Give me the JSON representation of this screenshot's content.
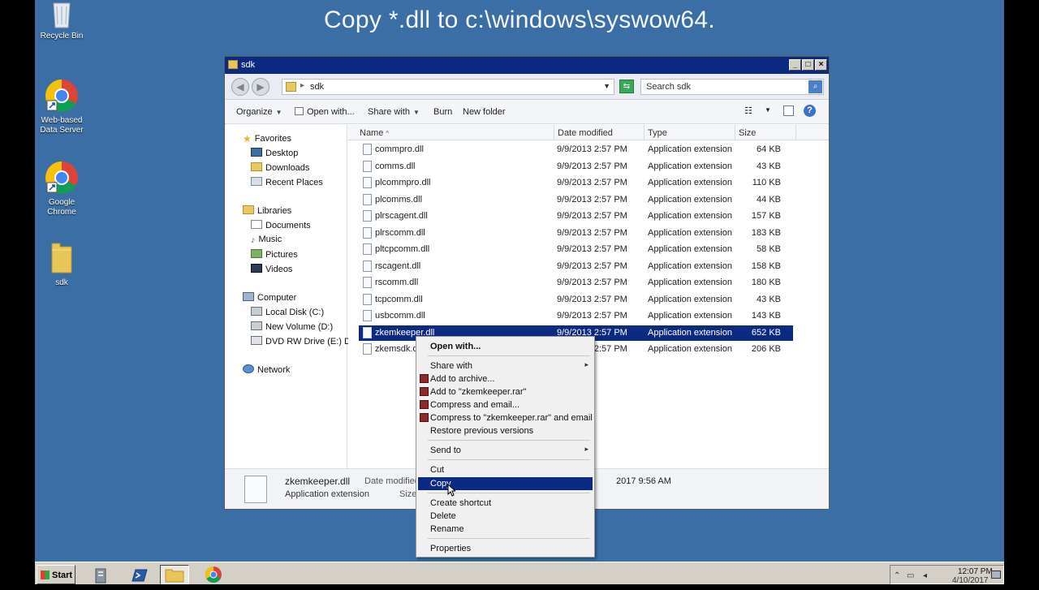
{
  "banner": {
    "text": "Copy *.dll to c:\\windows\\syswow64."
  },
  "desktop": {
    "icons": [
      {
        "label": "Recycle Bin"
      },
      {
        "label": "Web-based Data Server"
      },
      {
        "label": "Google Chrome"
      },
      {
        "label": "sdk"
      }
    ]
  },
  "window": {
    "title": "sdk",
    "address": {
      "path": "sdk"
    },
    "search_placeholder": "Search sdk",
    "toolbar": {
      "organize": "Organize",
      "open_with": "Open with...",
      "share_with": "Share with",
      "burn": "Burn",
      "new_folder": "New folder"
    },
    "nav": {
      "favorites": "Favorites",
      "desktop": "Desktop",
      "downloads": "Downloads",
      "recent_places": "Recent Places",
      "libraries": "Libraries",
      "documents": "Documents",
      "music": "Music",
      "pictures": "Pictures",
      "videos": "Videos",
      "computer": "Computer",
      "local_disk": "Local Disk (C:)",
      "new_volume": "New Volume (D:)",
      "dvd_drive": "DVD RW Drive (E:) DH",
      "network": "Network"
    },
    "columns": {
      "name": "Name",
      "date": "Date modified",
      "type": "Type",
      "size": "Size"
    },
    "files": [
      {
        "name": "commpro.dll",
        "date": "9/9/2013 2:57 PM",
        "type": "Application extension",
        "size": "64 KB"
      },
      {
        "name": "comms.dll",
        "date": "9/9/2013 2:57 PM",
        "type": "Application extension",
        "size": "43 KB"
      },
      {
        "name": "plcommpro.dll",
        "date": "9/9/2013 2:57 PM",
        "type": "Application extension",
        "size": "110 KB"
      },
      {
        "name": "plcomms.dll",
        "date": "9/9/2013 2:57 PM",
        "type": "Application extension",
        "size": "44 KB"
      },
      {
        "name": "plrscagent.dll",
        "date": "9/9/2013 2:57 PM",
        "type": "Application extension",
        "size": "157 KB"
      },
      {
        "name": "plrscomm.dll",
        "date": "9/9/2013 2:57 PM",
        "type": "Application extension",
        "size": "183 KB"
      },
      {
        "name": "pltcpcomm.dll",
        "date": "9/9/2013 2:57 PM",
        "type": "Application extension",
        "size": "58 KB"
      },
      {
        "name": "rscagent.dll",
        "date": "9/9/2013 2:57 PM",
        "type": "Application extension",
        "size": "158 KB"
      },
      {
        "name": "rscomm.dll",
        "date": "9/9/2013 2:57 PM",
        "type": "Application extension",
        "size": "180 KB"
      },
      {
        "name": "tcpcomm.dll",
        "date": "9/9/2013 2:57 PM",
        "type": "Application extension",
        "size": "43 KB"
      },
      {
        "name": "usbcomm.dll",
        "date": "9/9/2013 2:57 PM",
        "type": "Application extension",
        "size": "143 KB"
      },
      {
        "name": "zkemkeeper.dll",
        "date": "9/9/2013 2:57 PM",
        "type": "Application extension",
        "size": "652 KB"
      },
      {
        "name": "zkemsdk.dll",
        "date": "9/9/2013 2:57 PM",
        "type": "Application extension",
        "size": "206 KB"
      }
    ],
    "details": {
      "filename": "zkemkeeper.dll",
      "filetype": "Application extension",
      "date_label": "Date modified",
      "date_value": "2017 9:56 AM",
      "size_label": "Size"
    }
  },
  "context_menu": {
    "open_with": "Open with...",
    "share_with": "Share with",
    "add_archive": "Add to archive...",
    "add_rar": "Add to \"zkemkeeper.rar\"",
    "compress_email": "Compress and email...",
    "compress_rar_email": "Compress to \"zkemkeeper.rar\" and email",
    "restore": "Restore previous versions",
    "send_to": "Send to",
    "cut": "Cut",
    "copy": "Copy",
    "create_shortcut": "Create shortcut",
    "delete": "Delete",
    "rename": "Rename",
    "properties": "Properties"
  },
  "taskbar": {
    "start": "Start",
    "time": "12:07 PM",
    "date": "4/10/2017"
  },
  "colors": {
    "desktop": "#3a6ea5",
    "selection": "#0d2a83",
    "titlebar": "#0d2a83"
  }
}
